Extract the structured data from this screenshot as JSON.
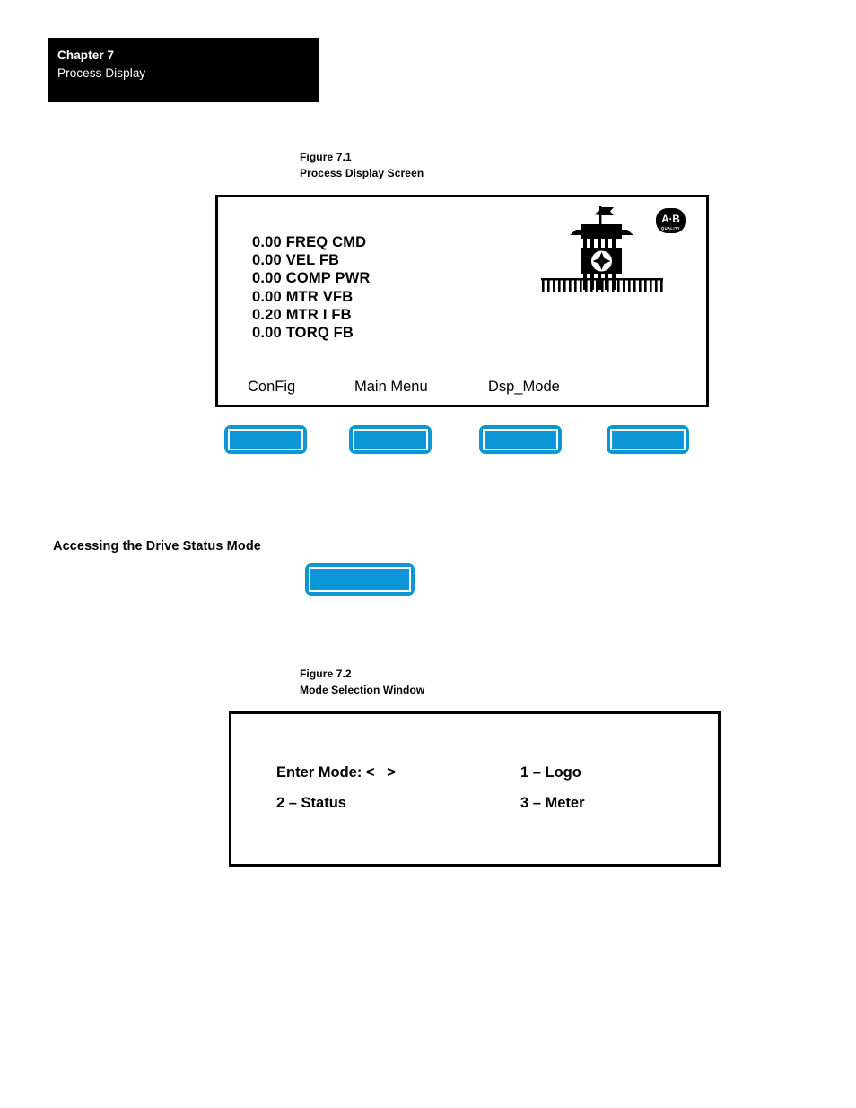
{
  "header": {
    "chapter": "Chapter 7",
    "title": "Process Display"
  },
  "figure1": {
    "number": "Figure 7.1",
    "title": "Process Display Screen",
    "screen": {
      "parameters": [
        {
          "value": "0.00",
          "label": "FREQ CMD"
        },
        {
          "value": "0.00",
          "label": "VEL FB"
        },
        {
          "value": "0.00",
          "label": "COMP PWR"
        },
        {
          "value": "0.00",
          "label": "MTR VFB"
        },
        {
          "value": "0.20",
          "label": "MTR I FB"
        },
        {
          "value": "0.00",
          "label": "TORQ FB"
        }
      ],
      "param_lines": [
        "0.00 FREQ CMD",
        "0.00 VEL FB",
        "0.00 COMP PWR",
        "0.00 MTR VFB",
        "0.20 MTR I FB",
        "0.00 TORQ FB"
      ],
      "softkeys": [
        "ConFig",
        "Main Menu",
        "Dsp_Mode"
      ],
      "logo": {
        "name": "allen-bradley-clock-tower",
        "badge_text": "A·B",
        "badge_subtext": "QUALITY"
      }
    },
    "buttons": [
      {
        "name": "softkey-button-1"
      },
      {
        "name": "softkey-button-2"
      },
      {
        "name": "softkey-button-3"
      },
      {
        "name": "softkey-button-4"
      }
    ]
  },
  "section": {
    "heading": "Accessing the Drive Status Mode",
    "button_name": "drive-status-mode-button"
  },
  "figure2": {
    "number": "Figure 7.2",
    "title": "Mode Selection Window",
    "window": {
      "prompt": "Enter Mode: <   >",
      "options": [
        "1 – Logo",
        "2 – Status",
        "3 – Meter"
      ]
    }
  },
  "colors": {
    "button_blue": "#0C96D6",
    "frame_black": "#000000",
    "page_white": "#FFFFFF"
  }
}
